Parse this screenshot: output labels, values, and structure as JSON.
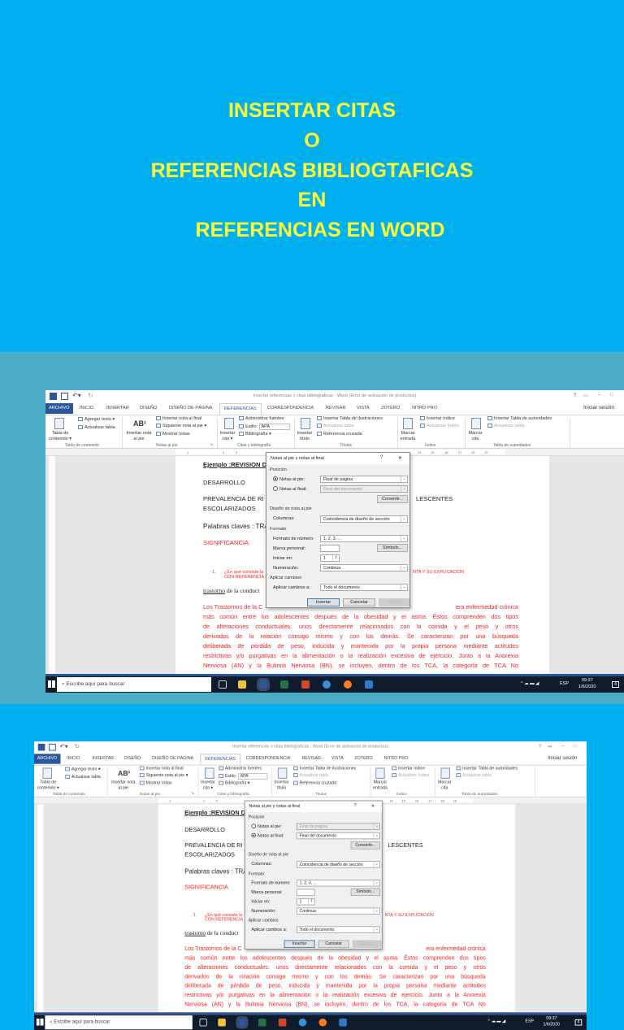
{
  "slide": {
    "title_lines": [
      "INSERTAR CITAS",
      "O",
      "REFERENCIAS BIBLIOGTAFICAS",
      "EN",
      "REFERENCIAS EN WORD"
    ],
    "colors": {
      "background": "#00B0F0",
      "band": "#4BACC6",
      "title": "#FFFF33"
    }
  },
  "word": {
    "window_title": "Insertar referencias o citas bibliograficas - Word (Error de activación de productos)",
    "sign_in": "Iniciar sesión",
    "window_controls": [
      "?",
      "▭",
      "–",
      "□"
    ],
    "tabs": [
      "ARCHIVO",
      "INICIO",
      "INSERTAR",
      "DISEÑO",
      "DISEÑO DE PÁGINA",
      "REFERENCIAS",
      "CORRESPONDENCIA",
      "REVISAR",
      "VISTA",
      "ZOTERO",
      "NITRO PRO"
    ],
    "active_tab": "REFERENCIAS",
    "ribbon": {
      "toc": {
        "big": "Tabla de contenido ▾",
        "add_text": "Agregar texto ▾",
        "update": "Actualizar tabla",
        "group": "Tabla de contenido"
      },
      "footnotes": {
        "big": "Insertar nota al pie",
        "big_icon": "AB¹",
        "insert_endnote": "Insertar nota al final",
        "next": "Siguiente nota al pie ▾",
        "show": "Mostrar notas",
        "group": "Notas al pie"
      },
      "citations": {
        "big": "Insertar cita ▾",
        "manage": "Administrar fuentes",
        "style_label": "Estilo:",
        "style_value": "APA",
        "bibliography": "Bibliografía ▾",
        "group": "Citas y bibliografía"
      },
      "captions": {
        "big": "Insertar título",
        "insert_table": "Insertar Tabla de ilustraciones",
        "update": "Actualizar tabla",
        "cross_ref": "Referencia cruzada",
        "group": "Títulos"
      },
      "index": {
        "big": "Marcar entrada",
        "insert": "Insertar índice",
        "update": "Actualizar índice",
        "group": "Índice"
      },
      "authorities": {
        "big": "Marcar cita",
        "insert": "Insertar Tabla de autoridades",
        "update": "Actualizar tabla",
        "group": "Tabla de autoridades"
      }
    },
    "ruler_numbers": [
      "1",
      "2",
      "3",
      "14",
      "15",
      "16",
      "17",
      "18",
      "19"
    ],
    "document": {
      "heading": "Ejemplo :REVISION D",
      "desarrollo": "DESARROLLO",
      "prevalencia_left": "PREVALENCIA DE RI",
      "prevalencia_right": "LESCENTES",
      "escolarizados": "ESCOLARIZADOS",
      "palabras": "Palabras claves :  TRA",
      "significancia": "SIGNIFICANCIA",
      "item_number": "1.",
      "item_left_1": "¿En qué consiste la",
      "item_left_2": "CON REFERENCIA",
      "item_right": "NTA Y SU EXPLICACION",
      "trastorno": "trastorno",
      "trastorno_rest": " de la conduct",
      "para_first_left": "Los Trastornos de la C",
      "para_first_right": "era enfermedad crónica",
      "para_lines": [
        "más común entre los adolescentes después de la obesidad y el asma. Éstos comprenden dos tipos",
        "de alteraciones conductuales: unos directamente relacionados con la comida y el peso y otros",
        "derivados de la relación consigo mismo y con los demás. Se caracterizan por una búsqueda",
        "deliberada de pérdida de peso, inducida y mantenida por la propia persona mediante actitudes",
        "restrictivas y/o purgativas en la alimentación o la realización excesiva de ejercicio. Junto a la Anorexia",
        "Nerviosa (AN) y la Bulimia Nerviosa (BN), se incluyen, dentro de los TCA, la categoría de TCA No"
      ]
    },
    "dialog": {
      "title": "Notas al pie y notas al final",
      "help": "?",
      "close": "✕",
      "position_header": "Posición",
      "footnotes_label": "Notas al pie:",
      "footnotes_value": "Final de página",
      "endnotes_label": "Notas al final:",
      "endnotes_value": "Final del documento",
      "convert": "Convertir...",
      "layout_header": "Diseño de nota al pie",
      "columns_label": "Columnas:",
      "columns_value": "Coincidencia de diseño de sección",
      "format_header": "Formato",
      "number_format_label": "Formato de número:",
      "number_format_value": "1, 2, 3, ...",
      "custom_mark_label": "Marca personal:",
      "symbol": "Símbolo...",
      "start_at_label": "Iniciar en:",
      "start_at_value": "1",
      "numbering_label": "Numeración:",
      "numbering_value": "Continua",
      "apply_header": "Aplicar cambios",
      "apply_to_label": "Aplicar cambios a:",
      "apply_to_value": "Todo el documento",
      "insert": "Insertar",
      "cancel": "Cancelar",
      "apply": "Aplicar"
    },
    "taskbar": {
      "search_placeholder": "Escribe aquí para buscar",
      "language": "ESP",
      "time": "09:37",
      "date": "1/6/2020",
      "notifications": "4"
    }
  }
}
